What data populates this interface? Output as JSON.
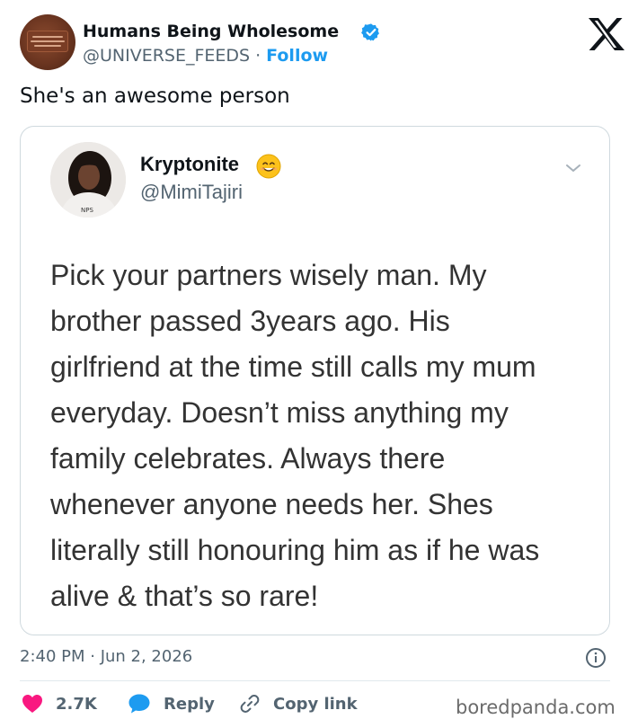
{
  "account": {
    "name": "Humans Being Wholesome",
    "handle": "@UNIVERSE_FEEDS",
    "separator": "·",
    "follow_label": "Follow"
  },
  "tweet": {
    "text": "She's an awesome person"
  },
  "quoted_tweet": {
    "name": "Kryptonite",
    "handle": "@MimiTajiri",
    "body_lines": [
      "Pick your partners wisely man. My",
      "brother passed 3years ago. His",
      "girlfriend at the time still calls my mum",
      "everyday. Doesn’t miss anything my",
      "family celebrates. Always there",
      "whenever anyone needs her. Shes",
      "literally still honouring him as if he was",
      "alive & that’s so rare!"
    ]
  },
  "meta": {
    "timestamp": "2:40 PM · Jun 2, 2026"
  },
  "actions": {
    "likes_count": "2.7K",
    "reply_label": "Reply",
    "copy_link_label": "Copy link"
  },
  "watermark": "boredpanda.com",
  "icons": {
    "verified": "verified-badge-icon",
    "x_logo": "x-logo-icon",
    "emoji": "smiling-face-emoji-icon",
    "chevron": "chevron-down-icon",
    "info": "info-icon",
    "heart": "heart-icon",
    "reply": "reply-bubble-icon",
    "link": "link-icon"
  },
  "colors": {
    "accent": "#1d9bf0",
    "heart": "#f91880",
    "text": "#0f1419",
    "muted": "#536471",
    "border": "#cfd9de"
  }
}
